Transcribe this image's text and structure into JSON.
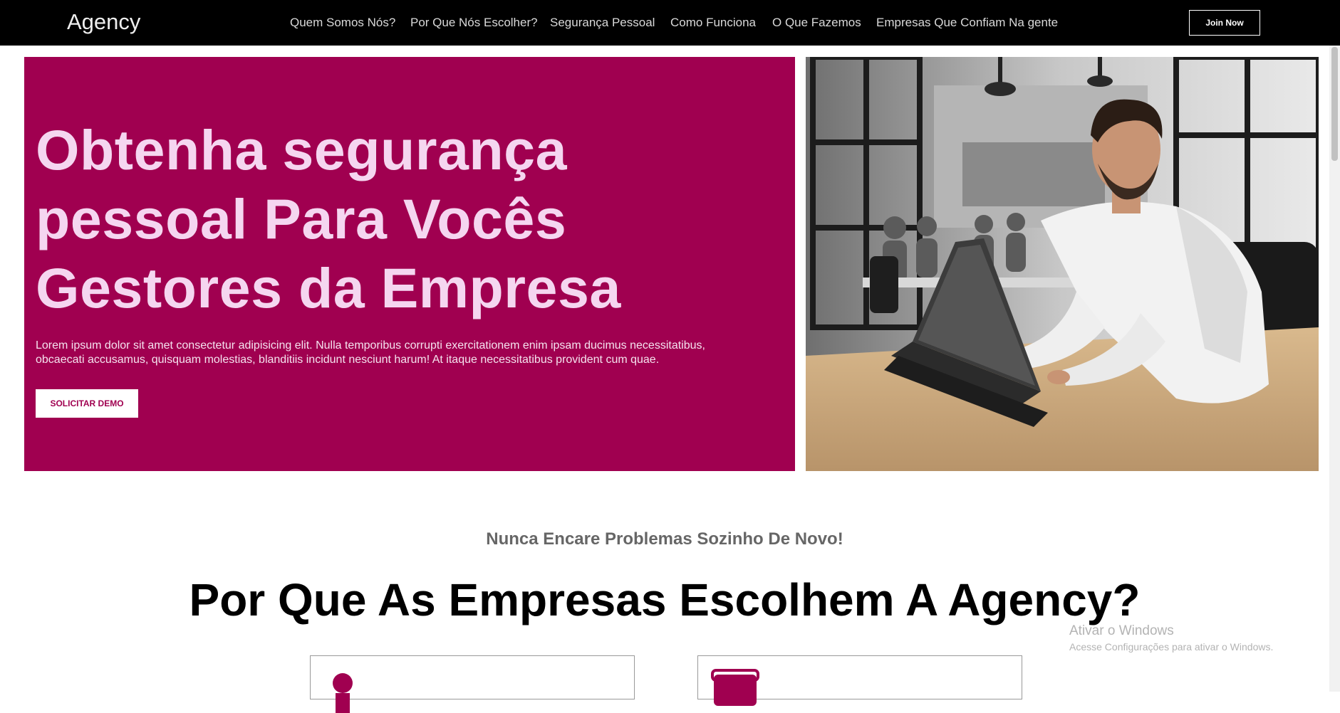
{
  "nav": {
    "brand": "Agency",
    "links": [
      "Quem Somos Nós?",
      "Por Que Nós Escolher?",
      "Segurança Pessoal",
      "Como Funciona",
      "O Que Fazemos",
      "Empresas Que Confiam Na gente"
    ],
    "join_label": "Join Now"
  },
  "hero": {
    "title": "Obtenha segurança pessoal Para Vocês Gestores da Empresa",
    "text": "Lorem ipsum dolor sit amet consectetur adipisicing elit. Nulla temporibus corrupti exercitationem enim ipsam ducimus necessitatibus, obcaecati accusamus, quisquam molestias, blanditiis incidunt nesciunt harum! At itaque necessitatibus provident cum quae.",
    "button_label": "SOLICITAR DEMO"
  },
  "section": {
    "subtitle": "Nunca Encare Problemas Sozinho De Novo!",
    "title": "Por Que As Empresas Escolhem A Agency?"
  },
  "watermark": {
    "title": "Ativar o Windows",
    "subtitle": "Acesse Configurações para ativar o Windows."
  },
  "colors": {
    "accent": "#a00050",
    "hero_title": "#f5d6f0",
    "nav_bg": "#000000"
  }
}
